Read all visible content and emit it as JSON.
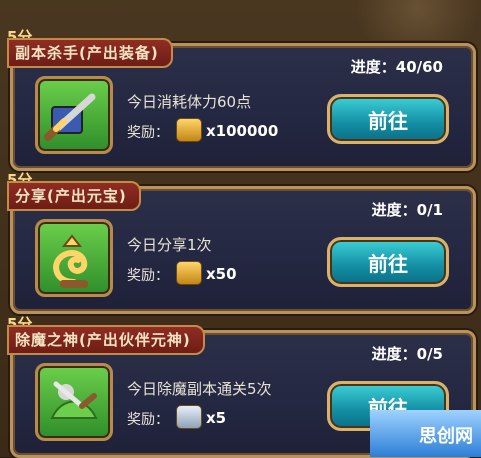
{
  "tasks": [
    {
      "points": "5分",
      "title": "副本杀手(产出装备)",
      "progress": "进度：40/60",
      "description": "今日消耗体力60点",
      "reward_label": "奖励：",
      "reward_value": "x100000",
      "reward_icon": "gold-coin-icon",
      "go_label": "前往",
      "icon": "sword-and-book-icon"
    },
    {
      "points": "5分",
      "title": "分享(产出元宝)",
      "progress": "进度：0/1",
      "description": "今日分享1次",
      "reward_label": "奖励：",
      "reward_value": "x50",
      "reward_icon": "gold-ingot-icon",
      "go_label": "前往",
      "icon": "share-swirl-icon"
    },
    {
      "points": "5分",
      "title": "除魔之神(产出伙伴元神)",
      "progress": "进度：0/5",
      "description": "今日除魔副本通关5次",
      "reward_label": "奖励：",
      "reward_value": "x5",
      "reward_icon": "spirit-crystal-icon",
      "go_label": "前往",
      "icon": "demon-slayer-scene-icon"
    }
  ],
  "watermark": {
    "text": "思创网"
  }
}
